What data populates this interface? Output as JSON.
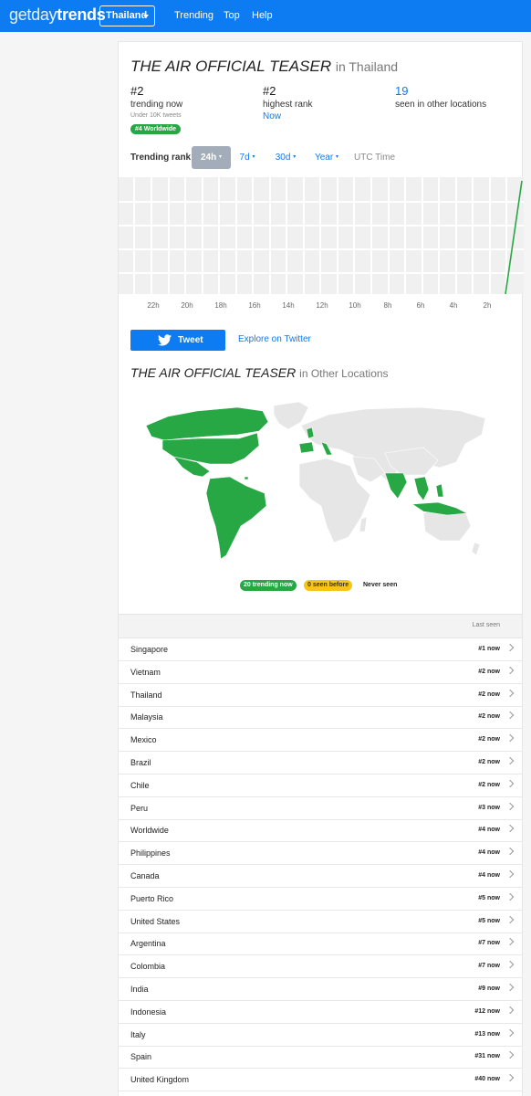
{
  "nav": {
    "brand_thin": "getday",
    "brand_bold": "trends",
    "country": "Thailand",
    "links": [
      "Trending",
      "Top",
      "Help"
    ]
  },
  "trend": {
    "name": "THE AIR OFFICIAL TEASER",
    "in_location": "in Thailand",
    "rank_now": "#2",
    "rank_now_label": "trending now",
    "volume": "Under 10K tweets",
    "worldwide_badge": "#4 Worldwide",
    "highest_rank": "#2",
    "highest_rank_label": "highest rank",
    "highest_rank_when": "Now",
    "other_locations_count": "19",
    "other_locations_label": "seen in other locations"
  },
  "rank_tabs": {
    "label": "Trending rank:",
    "tabs": [
      "24h",
      "7d",
      "30d",
      "Year"
    ],
    "active": "24h",
    "timezone": "UTC Time"
  },
  "chart_x_ticks": [
    "22h",
    "20h",
    "18h",
    "16h",
    "14h",
    "12h",
    "10h",
    "8h",
    "6h",
    "4h",
    "2h"
  ],
  "actions": {
    "tweet": "Tweet",
    "explore": "Explore on Twitter"
  },
  "other_locations": {
    "name": "THE AIR OFFICIAL TEASER",
    "suffix": "in Other Locations",
    "legend_trending": "20 trending now",
    "legend_seen": "0 seen before",
    "legend_never": "Never seen"
  },
  "table": {
    "header": "Last seen",
    "rows": [
      {
        "name": "Singapore",
        "rank": "#1 now"
      },
      {
        "name": "Vietnam",
        "rank": "#2 now"
      },
      {
        "name": "Thailand",
        "rank": "#2 now"
      },
      {
        "name": "Malaysia",
        "rank": "#2 now"
      },
      {
        "name": "Mexico",
        "rank": "#2 now"
      },
      {
        "name": "Brazil",
        "rank": "#2 now"
      },
      {
        "name": "Chile",
        "rank": "#2 now"
      },
      {
        "name": "Peru",
        "rank": "#3 now"
      },
      {
        "name": "Worldwide",
        "rank": "#4 now"
      },
      {
        "name": "Philippines",
        "rank": "#4 now"
      },
      {
        "name": "Canada",
        "rank": "#4 now"
      },
      {
        "name": "Puerto Rico",
        "rank": "#5 now"
      },
      {
        "name": "United States",
        "rank": "#5 now"
      },
      {
        "name": "Argentina",
        "rank": "#7 now"
      },
      {
        "name": "Colombia",
        "rank": "#7 now"
      },
      {
        "name": "India",
        "rank": "#9 now"
      },
      {
        "name": "Indonesia",
        "rank": "#12 now"
      },
      {
        "name": "Italy",
        "rank": "#13 now"
      },
      {
        "name": "Spain",
        "rank": "#31 now"
      },
      {
        "name": "United Kingdom",
        "rank": "#40 now"
      }
    ]
  },
  "colors": {
    "brand_blue": "#0d7bf2",
    "trending_green": "#28a745",
    "seen_yellow": "#f5c518",
    "never_grey": "#e6e6e6"
  }
}
